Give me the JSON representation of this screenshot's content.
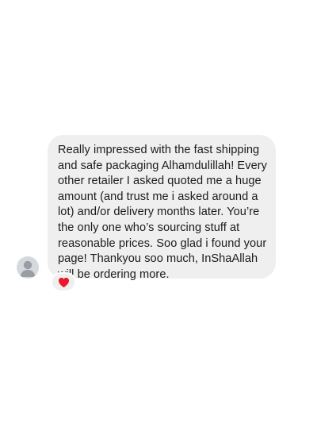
{
  "message": {
    "text": "Really impressed with the fast shipping and safe packaging Alhamdulillah! Every other retailer I asked quoted me a huge amount (and trust me i asked around a lot) and/or delivery months later. You’re the only one who’s sourcing stuff at reasonable prices. Soo glad i found your page! Thankyou soo much, InShaAllah will be ordering more.",
    "reaction": {
      "icon": "heart-icon",
      "color": "#e8192c"
    }
  },
  "sender": {
    "avatar_icon": "default-user-avatar-icon"
  },
  "colors": {
    "bubble": "#efefef",
    "text": "#1b1b1b",
    "avatar_bg": "#d5d8dc",
    "avatar_fg": "#9a9ea4"
  }
}
